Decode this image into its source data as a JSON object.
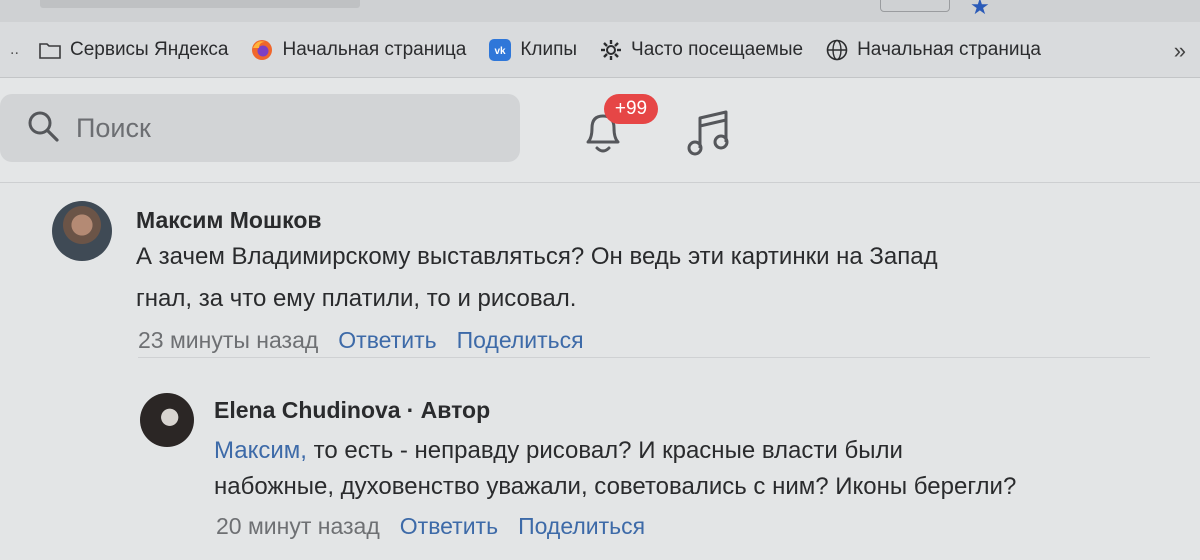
{
  "bookmarks": {
    "items": [
      {
        "label": "Сервисы Яндекса",
        "icon": "folder-icon"
      },
      {
        "label": "Начальная страница",
        "icon": "firefox-icon"
      },
      {
        "label": "Клипы",
        "icon": "vk-icon"
      },
      {
        "label": "Часто посещаемые",
        "icon": "gear-icon"
      },
      {
        "label": "Начальная страница",
        "icon": "globe-icon"
      }
    ],
    "more": "»",
    "overflow_left": ".."
  },
  "header": {
    "search_placeholder": "Поиск",
    "notification_badge": "+99"
  },
  "comments": [
    {
      "author": "Максим Мошков",
      "text_line1": "А зачем Владимирскому выставляться? Он ведь эти картинки на Запад",
      "text_line2": "гнал, за что ему платили, то и рисовал.",
      "time": "23 минуты назад",
      "reply": "Ответить",
      "share": "Поделиться"
    },
    {
      "author": "Elena Chudinova",
      "author_tag": "· Автор",
      "mention": "Максим,",
      "text_line1": " то есть - неправду рисовал? И красные власти были",
      "text_line2": "набожные, духовенство уважали, советовались с ним? Иконы берегли?",
      "time": "20 минут назад",
      "reply": "Ответить",
      "share": "Поделиться"
    }
  ],
  "colors": {
    "accent": "#3d6aa8",
    "badge": "#e64646"
  }
}
